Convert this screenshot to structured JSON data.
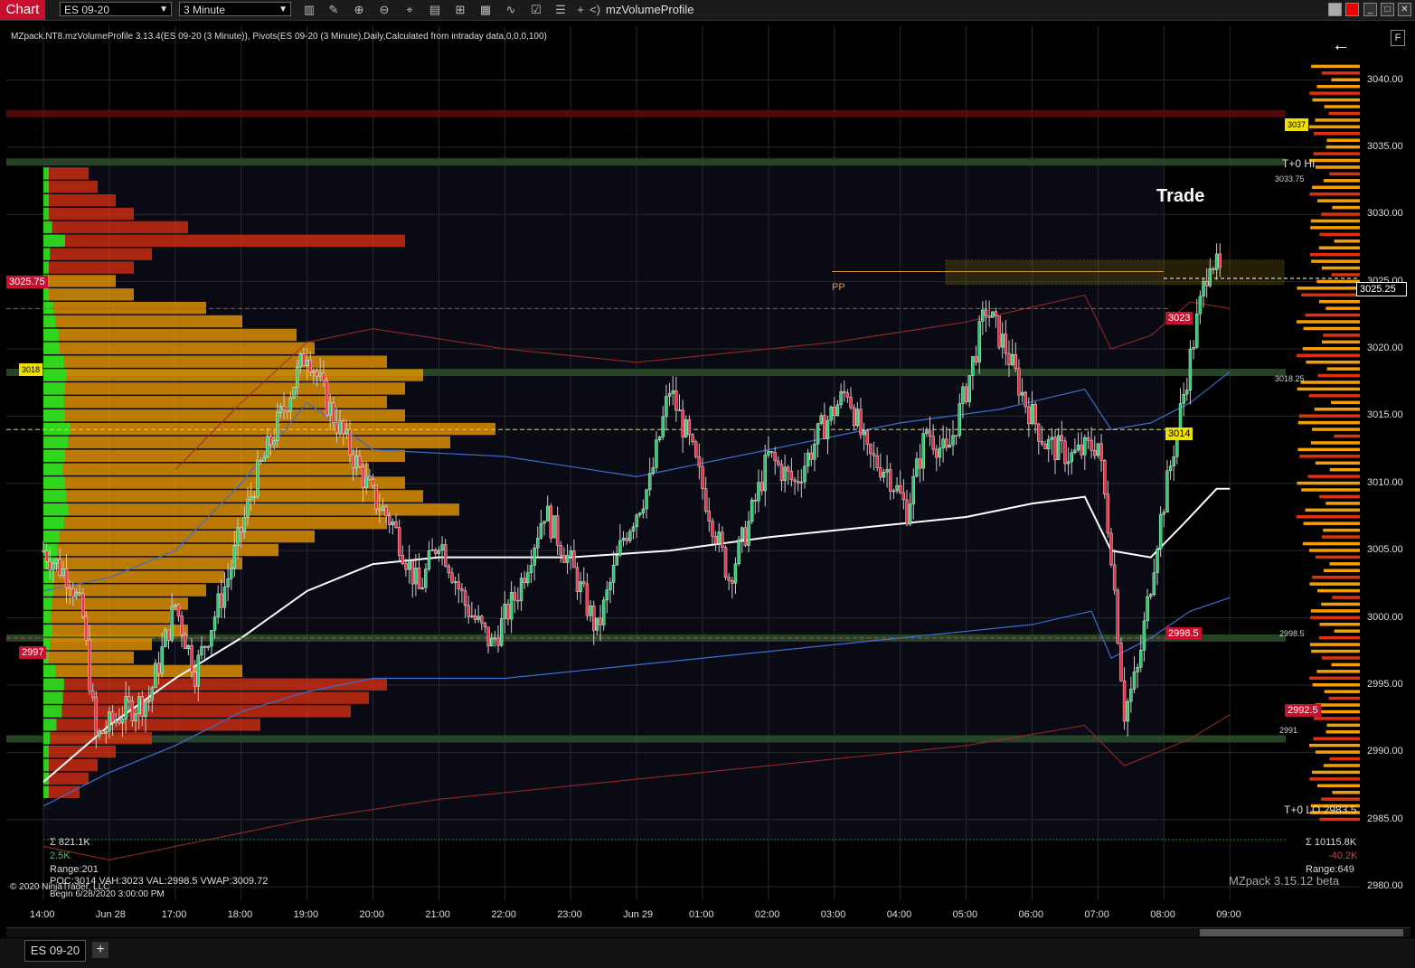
{
  "toolbar": {
    "chart_label": "Chart",
    "instrument": "ES 09-20",
    "interval": "3 Minute",
    "indicator_name": "mzVolumeProfile",
    "icons": [
      "bar-type-icon",
      "draw-icon",
      "zoom-in-icon",
      "zoom-out-icon",
      "crosshair-icon",
      "data-box-icon",
      "indicators-icon",
      "strategies-icon",
      "chart-style-icon",
      "properties-icon",
      "list-icon",
      "plus-icon",
      "arrows-icon"
    ]
  },
  "chart": {
    "header": "MZpack.NT8.mzVolumeProfile 3.13.4(ES 09-20 (3 Minute)), Pivots(ES 09-20 (3 Minute),Daily,Calculated from intraday data,0,0,0,100)",
    "trade_label": "Trade",
    "pp_label": "PP",
    "t0_hi": "T+0 HI",
    "t0_lo": "T+0 LO 2983.5",
    "stats_left": [
      "Σ 821.1K",
      "2.5K",
      "Range:201"
    ],
    "stats_right": [
      "Σ 10115.8K",
      "-40.2K",
      "Range:649"
    ],
    "poc_line": "POC:3014 VAH:3023 VAL:2998.5 VWAP:3009.72",
    "begin_line": "Begin 6/28/2020 3:00:00 PM",
    "copyright": "© 2020 NinjaTrader, LLC",
    "watermark": "MZpack 3.15.12 beta",
    "f_button": "F"
  },
  "price_tags": {
    "current": "3025.25",
    "left_3025": "3025.75",
    "left_3018": "3018",
    "left_2997": "2997",
    "vah": "3023",
    "poc": "3014",
    "val": "2998.5",
    "r_2992": "2992.5",
    "level_3033": "3033.75",
    "level_3018": "3018.25",
    "level_2998": "2998.5",
    "level_2991": "2991",
    "level_3037": "3037"
  },
  "colors": {
    "up": "#2ecc71",
    "down": "#e8334a",
    "profile_orange": "#f5a000",
    "profile_red": "#e03010",
    "profile_green": "#20e020",
    "level_band": "#2a4a2a",
    "vwap": "#ffffff",
    "blue_band": "#3a6fd0",
    "red_band": "#a02a2a"
  },
  "chart_data": {
    "type": "candlestick",
    "instrument": "ES 09-20",
    "interval": "3 Minute",
    "ylim": [
      2979,
      3044
    ],
    "y_ticks": [
      3040,
      3035,
      3030,
      3025,
      3020,
      3015,
      3010,
      3005,
      3000,
      2995,
      2990,
      2985,
      2980
    ],
    "x_ticks": [
      "14:00",
      "Jun 28",
      "17:00",
      "18:00",
      "19:00",
      "20:00",
      "21:00",
      "22:00",
      "23:00",
      "Jun 29",
      "01:00",
      "02:00",
      "03:00",
      "04:00",
      "05:00",
      "06:00",
      "07:00",
      "08:00",
      "09:00"
    ],
    "price_path": [
      [
        0,
        3005
      ],
      [
        0.4,
        3003
      ],
      [
        0.6,
        3000
      ],
      [
        0.8,
        2991
      ],
      [
        1.2,
        2993
      ],
      [
        1.6,
        2994
      ],
      [
        2.0,
        3001
      ],
      [
        2.3,
        2996
      ],
      [
        2.8,
        3003
      ],
      [
        3.2,
        3010
      ],
      [
        3.6,
        3015
      ],
      [
        4.0,
        3020
      ],
      [
        4.3,
        3016
      ],
      [
        4.7,
        3012
      ],
      [
        5.0,
        3009
      ],
      [
        5.3,
        3007
      ],
      [
        5.7,
        3002
      ],
      [
        6.0,
        3006
      ],
      [
        6.4,
        3001
      ],
      [
        6.8,
        2998
      ],
      [
        7.2,
        3002
      ],
      [
        7.6,
        3008
      ],
      [
        8.0,
        3004
      ],
      [
        8.4,
        2999
      ],
      [
        8.8,
        3006
      ],
      [
        9.2,
        3010
      ],
      [
        9.5,
        3017
      ],
      [
        9.8,
        3013
      ],
      [
        10.1,
        3008
      ],
      [
        10.4,
        3003
      ],
      [
        10.7,
        3007
      ],
      [
        11.0,
        3012
      ],
      [
        11.4,
        3010
      ],
      [
        11.8,
        3014
      ],
      [
        12.2,
        3017
      ],
      [
        12.5,
        3012
      ],
      [
        12.8,
        3011
      ],
      [
        13.1,
        3008
      ],
      [
        13.4,
        3014
      ],
      [
        13.7,
        3012
      ],
      [
        14.0,
        3017
      ],
      [
        14.3,
        3023
      ],
      [
        14.6,
        3020
      ],
      [
        14.9,
        3016
      ],
      [
        15.2,
        3013
      ],
      [
        15.6,
        3012
      ],
      [
        16.0,
        3013
      ],
      [
        16.2,
        3005
      ],
      [
        16.4,
        2993
      ],
      [
        16.6,
        2996
      ],
      [
        16.9,
        3006
      ],
      [
        17.2,
        3014
      ],
      [
        17.5,
        3022
      ],
      [
        17.7,
        3027
      ],
      [
        17.9,
        3025
      ]
    ],
    "levels": {
      "poc": 3014,
      "vah": 3023,
      "val": 2998.5,
      "vwap": 3009.72,
      "pp": 3025.75,
      "t0_lo": 2983.5
    },
    "profile_left": [
      [
        3033,
        0.05
      ],
      [
        3032,
        0.06
      ],
      [
        3031,
        0.08
      ],
      [
        3030,
        0.1
      ],
      [
        3029,
        0.16
      ],
      [
        3028,
        0.4
      ],
      [
        3027,
        0.12
      ],
      [
        3026,
        0.1
      ],
      [
        3025,
        0.08
      ],
      [
        3024,
        0.1
      ],
      [
        3023,
        0.18
      ],
      [
        3022,
        0.22
      ],
      [
        3021,
        0.28
      ],
      [
        3020,
        0.3
      ],
      [
        3019,
        0.38
      ],
      [
        3018,
        0.42
      ],
      [
        3017,
        0.4
      ],
      [
        3016,
        0.38
      ],
      [
        3015,
        0.4
      ],
      [
        3014,
        0.5
      ],
      [
        3013,
        0.45
      ],
      [
        3012,
        0.4
      ],
      [
        3011,
        0.36
      ],
      [
        3010,
        0.4
      ],
      [
        3009,
        0.42
      ],
      [
        3008,
        0.46
      ],
      [
        3007,
        0.38
      ],
      [
        3006,
        0.3
      ],
      [
        3005,
        0.26
      ],
      [
        3004,
        0.22
      ],
      [
        3003,
        0.2
      ],
      [
        3002,
        0.18
      ],
      [
        3001,
        0.16
      ],
      [
        3000,
        0.14
      ],
      [
        2999,
        0.16
      ],
      [
        2998,
        0.12
      ],
      [
        2997,
        0.1
      ],
      [
        2996,
        0.22
      ],
      [
        2995,
        0.38
      ],
      [
        2994,
        0.36
      ],
      [
        2993,
        0.34
      ],
      [
        2992,
        0.24
      ],
      [
        2991,
        0.12
      ],
      [
        2990,
        0.08
      ],
      [
        2989,
        0.06
      ],
      [
        2988,
        0.05
      ],
      [
        2987,
        0.04
      ]
    ]
  }
}
